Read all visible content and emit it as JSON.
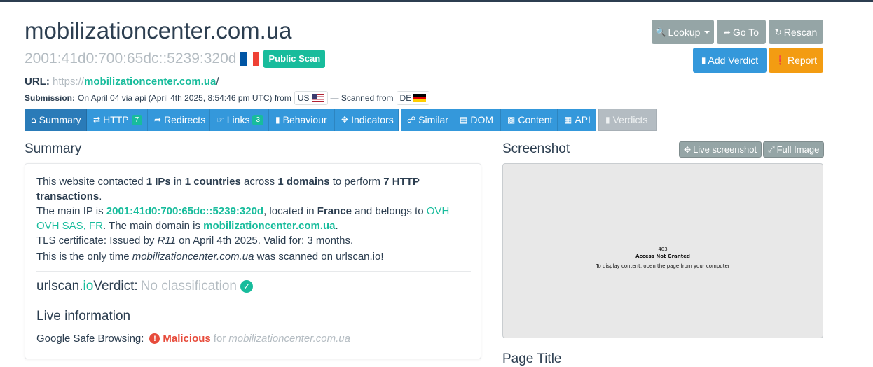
{
  "header": {
    "domain": "mobilizationcenter.com.ua",
    "ip": "2001:41d0:700:65dc::5239:320d",
    "country_flag": "fr",
    "scan_badge": "Public Scan"
  },
  "actions": {
    "lookup": "Lookup",
    "goto": "Go To",
    "rescan": "Rescan",
    "add_verdict": "Add Verdict",
    "report": "Report"
  },
  "url": {
    "label": "URL:",
    "prefix": "https://",
    "host": "mobilizationcenter.com.ua",
    "suffix": "/"
  },
  "submission": {
    "label": "Submission:",
    "text": "On April 04 via api (April 4th 2025, 8:54:46 pm UTC) from",
    "from_country": "US",
    "scanned_text": "— Scanned from",
    "scanned_country": "DE"
  },
  "tabs": {
    "summary": "Summary",
    "http": "HTTP",
    "http_count": "7",
    "redirects": "Redirects",
    "links": "Links",
    "links_count": "3",
    "behaviour": "Behaviour",
    "indicators": "Indicators",
    "similar": "Similar",
    "dom": "DOM",
    "content": "Content",
    "api": "API",
    "verdicts": "Verdicts"
  },
  "summary": {
    "heading": "Summary",
    "p1_a": "This website contacted ",
    "p1_ips": "1 IPs",
    "p1_b": " in ",
    "p1_countries": "1 countries",
    "p1_c": " across ",
    "p1_domains": "1 domains",
    "p1_d": " to perform ",
    "p1_http": "7 HTTP transactions",
    "p1_e": ".",
    "p2_a": "The main IP is ",
    "p2_ip": "2001:41d0:700:65dc::5239:320d",
    "p2_b": ", located in ",
    "p2_country": "France",
    "p2_c": " and belongs to ",
    "p2_asn": "OVH OVH SAS, FR",
    "p2_d": ". The main domain is ",
    "p2_domain": "mobilizationcenter.com.ua",
    "p2_e": ".",
    "p3_a": "TLS certificate: Issued by ",
    "p3_issuer": "R11",
    "p3_b": " on April 4th 2025. Valid for: 3 months.",
    "only_a": "This is the only time ",
    "only_domain": "mobilizationcenter.com.ua",
    "only_b": " was scanned on urlscan.io!",
    "verdict_brand_a": "urlscan.",
    "verdict_brand_b": "io",
    "verdict_label": " Verdict: ",
    "verdict_value": "No classification",
    "live_heading": "Live information",
    "gsb_label": "Google Safe Browsing:",
    "gsb_value": "Malicious",
    "gsb_for": "for",
    "gsb_domain": "mobilizationcenter.com.ua"
  },
  "screenshot": {
    "heading": "Screenshot",
    "live_button": "Live screenshot",
    "full_button": "Full Image",
    "code": "403",
    "title": "Access Not Granted",
    "message": "To display content, open the page from your computer"
  },
  "page_title": {
    "heading": "Page Title"
  },
  "colors": {
    "primary": "#2c3e50",
    "accent_green": "#18bc9c",
    "blue": "#3498db",
    "grey": "#95a5a6",
    "orange": "#f39c12",
    "danger": "#e74c3c"
  }
}
